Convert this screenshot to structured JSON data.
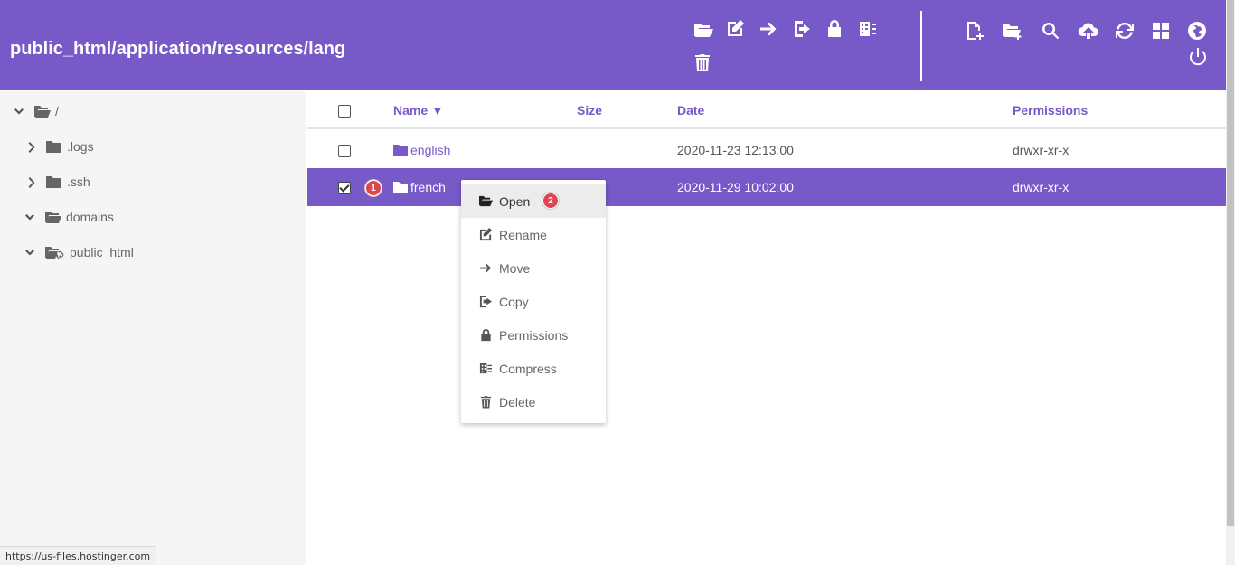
{
  "header": {
    "title": "public_html/application/resources/lang",
    "toolbar_left": [
      "open-folder-icon",
      "edit-icon",
      "arrow-right-icon",
      "copy-icon",
      "lock-icon",
      "compress-icon",
      "trash-icon"
    ],
    "toolbar_right": [
      "new-file-icon",
      "new-folder-icon",
      "search-icon",
      "upload-icon",
      "refresh-icon",
      "grid-icon",
      "globe-icon",
      "power-icon"
    ],
    "background": "#7759c8"
  },
  "sidebar": {
    "items": [
      {
        "label": "/",
        "expanded": true,
        "icon": "folder-open-icon"
      },
      {
        "label": ".logs",
        "expanded": false,
        "icon": "folder-icon"
      },
      {
        "label": ".ssh",
        "expanded": false,
        "icon": "folder-icon"
      },
      {
        "label": "domains",
        "expanded": true,
        "icon": "folder-open-icon"
      },
      {
        "label": "public_html",
        "expanded": true,
        "icon": "folder-link-icon"
      }
    ]
  },
  "table": {
    "headers": {
      "name": "Name ▼",
      "size": "Size",
      "date": "Date",
      "permissions": "Permissions"
    },
    "rows": [
      {
        "name": "english",
        "size": "",
        "date": "2020-11-23 12:13:00",
        "permissions": "drwxr-xr-x",
        "selected": false
      },
      {
        "name": "french",
        "size": "",
        "date": "2020-11-29 10:02:00",
        "permissions": "drwxr-xr-x",
        "selected": true
      }
    ]
  },
  "badges": {
    "one": "1",
    "two": "2"
  },
  "context_menu": {
    "items": [
      {
        "label": "Open",
        "icon": "folder-open-icon"
      },
      {
        "label": "Rename",
        "icon": "edit-icon"
      },
      {
        "label": "Move",
        "icon": "arrow-right-icon"
      },
      {
        "label": "Copy",
        "icon": "copy-icon"
      },
      {
        "label": "Permissions",
        "icon": "lock-icon"
      },
      {
        "label": "Compress",
        "icon": "compress-icon"
      },
      {
        "label": "Delete",
        "icon": "trash-icon"
      }
    ]
  },
  "status": {
    "url": "https://us-files.hostinger.com"
  },
  "colors": {
    "accent": "#7759c8",
    "badge": "#e0454f"
  }
}
